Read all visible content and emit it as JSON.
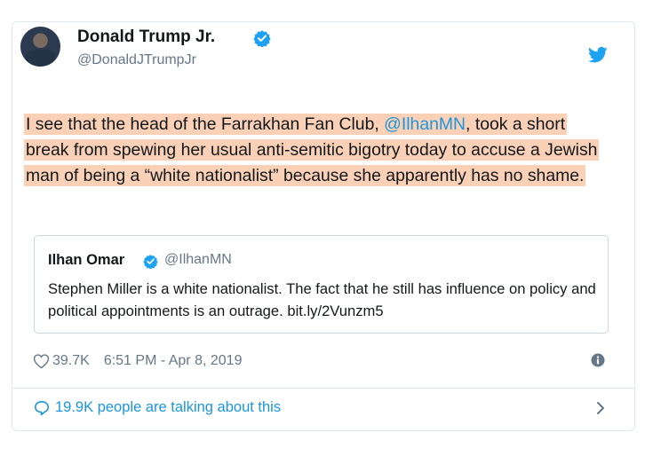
{
  "author": {
    "name": "Donald Trump Jr.",
    "handle": "@DonaldJTrumpJr"
  },
  "tweet": {
    "before_mention": "I see that the head of the Farrakhan Fan Club, ",
    "mention": "@IlhanMN",
    "after_mention": ", took a short break from spewing her usual anti-semitic bigotry today to accuse a Jewish man of being a “white nationalist” because she apparently has no shame."
  },
  "quoted": {
    "name": "Ilhan Omar",
    "handle": "@IlhanMN",
    "text": "Stephen Miller is a white nationalist. The fact that he still has influence on policy and political appointments is an outrage. bit.ly/2Vunzm5"
  },
  "meta": {
    "likes": "39.7K",
    "timestamp": "6:51 PM - Apr 8, 2019"
  },
  "footer": {
    "talking": "19.9K people are talking about this"
  },
  "colors": {
    "highlight": "#fad1b6",
    "link": "#1b95e0",
    "muted": "#657786",
    "verified": "#1da1f2"
  },
  "icons": [
    "verified-badge-icon",
    "twitter-bird-icon",
    "heart-icon",
    "info-icon",
    "speech-bubble-icon",
    "chevron-right-icon"
  ]
}
